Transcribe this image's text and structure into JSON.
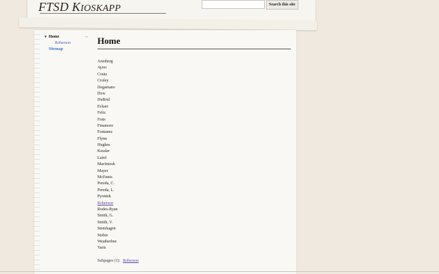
{
  "header": {
    "site_title_main": "FTSD K",
    "site_title_rest": "IOSKAPP",
    "search": {
      "placeholder": "",
      "button_label": "Search this site"
    }
  },
  "sidebar": {
    "toggle_icon": "▼",
    "arrow_icon": "→",
    "items": [
      {
        "label": "Home"
      },
      {
        "label": "Roberson"
      },
      {
        "label": "Sitemap"
      }
    ]
  },
  "main": {
    "title": "Home",
    "names": [
      "Arenberg",
      "Ayrer",
      "Coutz",
      "Croley",
      "Degaetano",
      "Dow",
      "DuBrul",
      "Eckart",
      "Feliz",
      "Fons",
      "Finamore",
      "Fontanez",
      "Flynn",
      "Hughes",
      "Kessler",
      "Laird",
      "MacIntosh",
      "Mayer",
      "McEnnis",
      "Pereda, C.",
      "Pereda, L.",
      "Pyontek",
      "Roberson",
      "Rodes-Ryan",
      "Smith, G.",
      "Smith, V.",
      "Stemhagen",
      "Stobie",
      "Weatherbee",
      "Yaris"
    ],
    "subpages_label": "Subpages (1):",
    "subpages_link": "Roberson"
  },
  "colors": {
    "background": "#efe9df",
    "link_visited": "#5e3f9e",
    "link_blue": "#3b77c8"
  }
}
